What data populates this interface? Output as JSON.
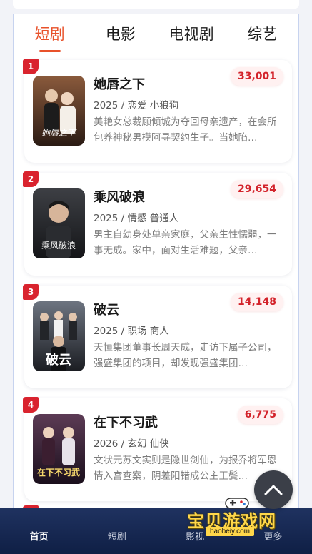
{
  "tabs": [
    {
      "label": "短剧",
      "active": true
    },
    {
      "label": "电影",
      "active": false
    },
    {
      "label": "电视剧",
      "active": false
    },
    {
      "label": "综艺",
      "active": false
    }
  ],
  "items": [
    {
      "rank": "1",
      "title": "她唇之下",
      "heat": "33,001",
      "meta": "2025 / 恋爱 小狼狗",
      "desc": "美艳女总裁顾倾城为夺回母亲遗产，在会所包养神秘男模阿寻契约生子。当她陷…",
      "poster_text": "她唇之下",
      "poster_colors": [
        "#8a5a3c",
        "#2b1b14"
      ]
    },
    {
      "rank": "2",
      "title": "乘风破浪",
      "heat": "29,654",
      "meta": "2025 / 情感 普通人",
      "desc": "男主自幼身处单亲家庭，父亲生性懦弱，一事无成。家中，面对生活难题，父亲…",
      "poster_text": "乘风破浪",
      "poster_colors": [
        "#3d3f44",
        "#141518"
      ]
    },
    {
      "rank": "3",
      "title": "破云",
      "heat": "14,148",
      "meta": "2025 / 职场 商人",
      "desc": "天恒集团董事长周天成，走访下属子公司，强盛集团的项目，却发现强盛集团…",
      "poster_text": "破云",
      "poster_colors": [
        "#6d7480",
        "#1b1d22"
      ]
    },
    {
      "rank": "4",
      "title": "在下不习武",
      "heat": "6,775",
      "meta": "2026 / 玄幻 仙侠",
      "desc": "文状元苏文实则是隐世剑仙，为报乔将军恩情入宫查案，阴差阳错成公主王鬓…",
      "poster_text": "在下不习武",
      "poster_colors": [
        "#5c3b55",
        "#1a0f1c"
      ]
    }
  ],
  "nav": [
    {
      "label": "首页",
      "active": true
    },
    {
      "label": "短剧",
      "active": false
    },
    {
      "label": "影视",
      "active": false
    },
    {
      "label": "更多",
      "active": false
    }
  ],
  "watermark": {
    "text": "宝贝游戏网",
    "url": "baobeiy.com"
  },
  "colors": {
    "accent": "#e8512a",
    "rank_badge": "#d9232e",
    "heat": "#d3232b",
    "nav_bg": "#1f3260"
  }
}
